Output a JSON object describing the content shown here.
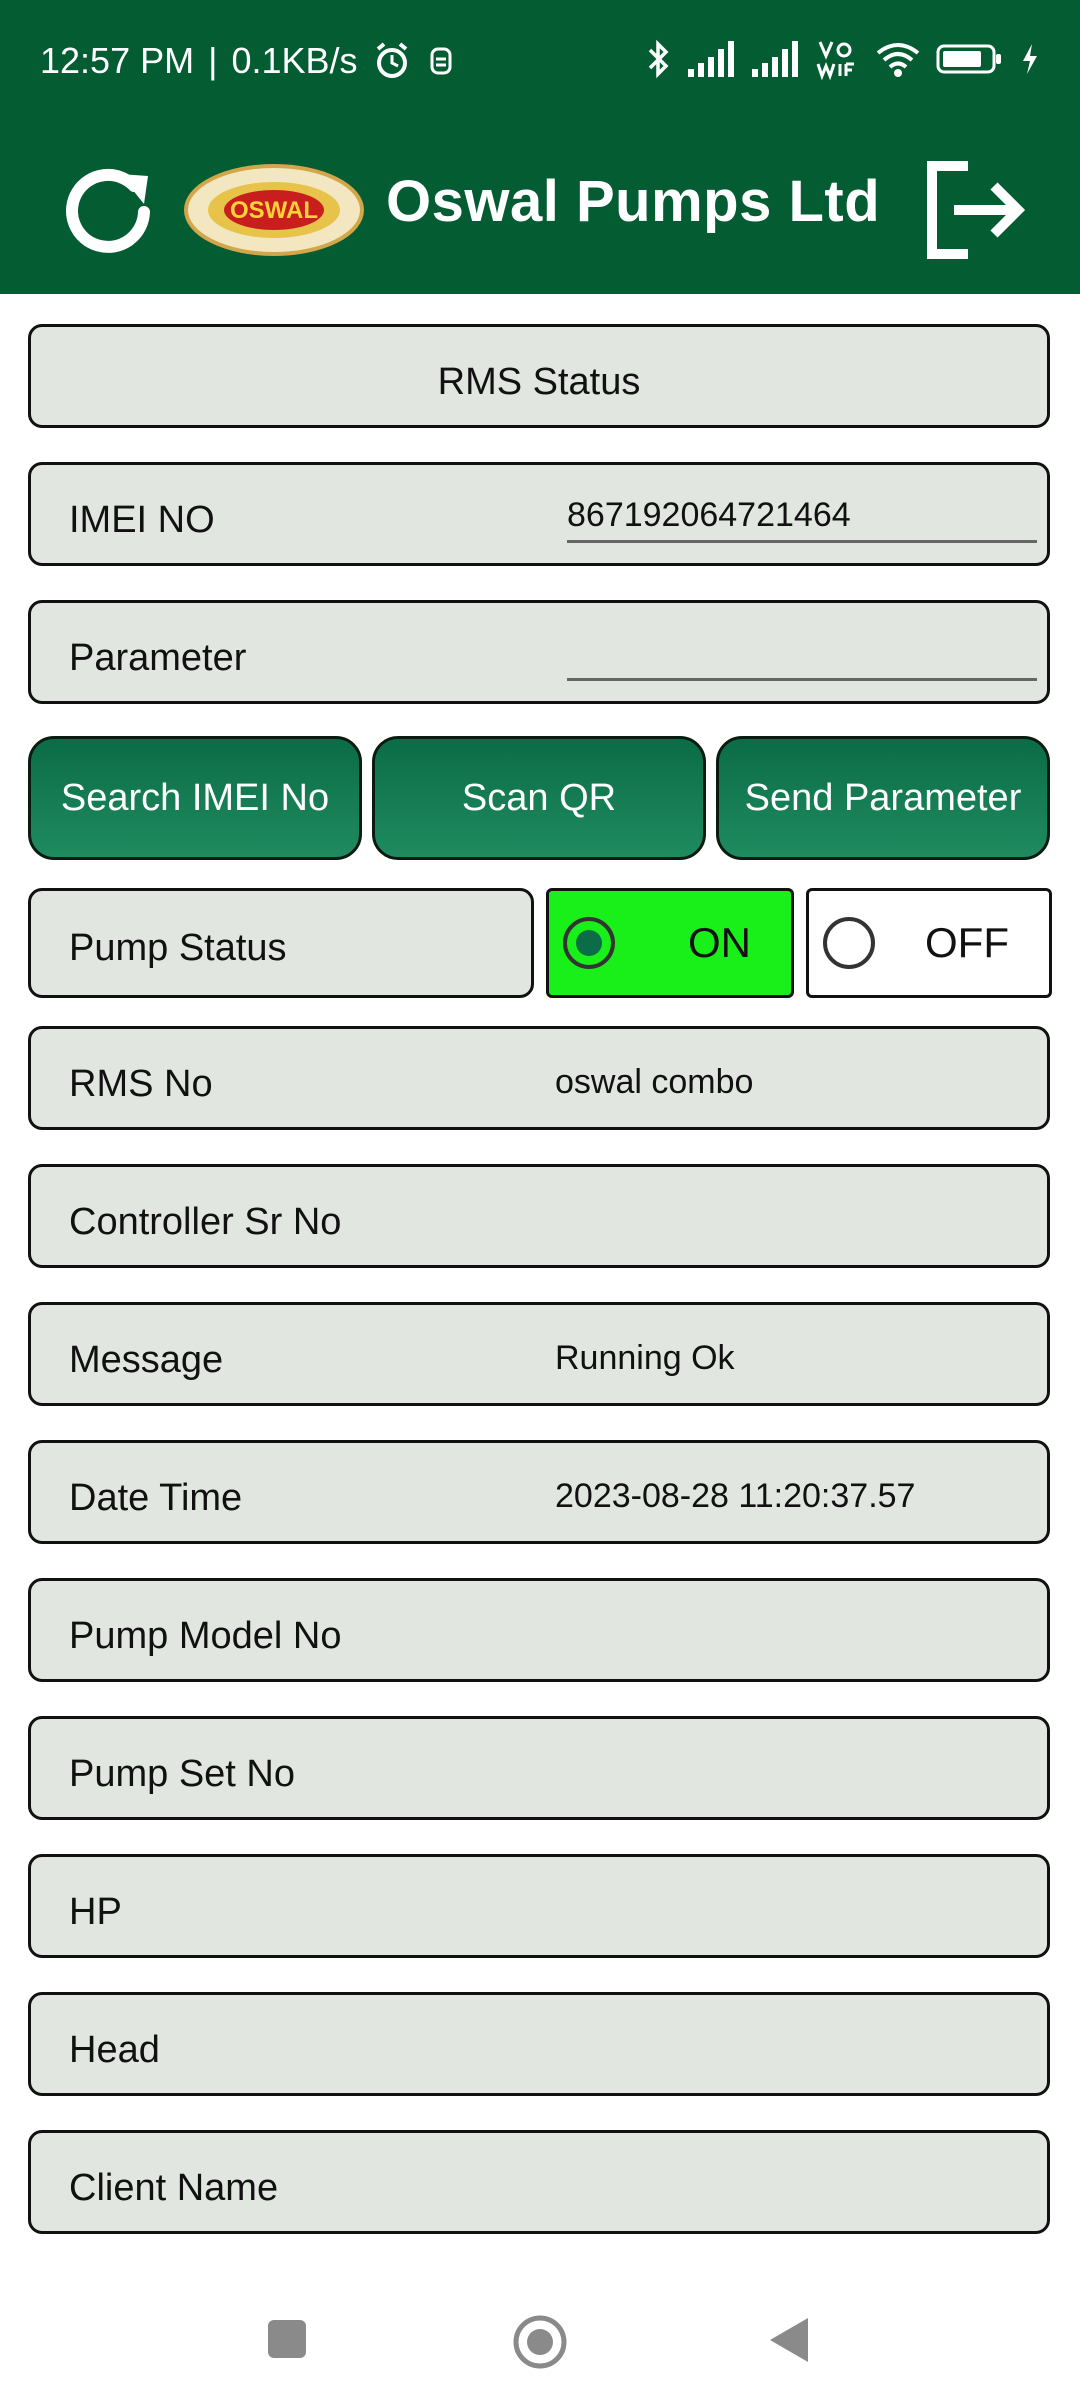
{
  "status_bar": {
    "time": "12:57 PM",
    "speed": "0.1KB/s"
  },
  "app_bar": {
    "title": "Oswal Pumps Ltd",
    "logo_text": "OSWAL"
  },
  "form": {
    "header": "RMS Status",
    "imei": {
      "label": "IMEI NO",
      "value": "867192064721464"
    },
    "parameter": {
      "label": "Parameter",
      "value": ""
    },
    "buttons": {
      "search": "Search IMEI No",
      "scan": "Scan QR",
      "send": "Send Parameter"
    },
    "pump_status": {
      "label": "Pump Status",
      "on_label": "ON",
      "off_label": "OFF",
      "selected": "ON"
    },
    "rms_no": {
      "label": "RMS No",
      "value": "oswal combo"
    },
    "controller_sr_no": {
      "label": "Controller Sr No",
      "value": ""
    },
    "message": {
      "label": "Message",
      "value": "Running Ok"
    },
    "date_time": {
      "label": "Date Time",
      "value": "2023-08-28 11:20:37.57"
    },
    "pump_model_no": {
      "label": "Pump Model No",
      "value": ""
    },
    "pump_set_no": {
      "label": "Pump Set No",
      "value": ""
    },
    "hp": {
      "label": "HP",
      "value": ""
    },
    "head": {
      "label": "Head",
      "value": ""
    },
    "client_name": {
      "label": "Client Name",
      "value": ""
    }
  },
  "colors": {
    "primary": "#045C33",
    "on_green": "#19F01A",
    "row_bg": "#E2E6E1"
  }
}
